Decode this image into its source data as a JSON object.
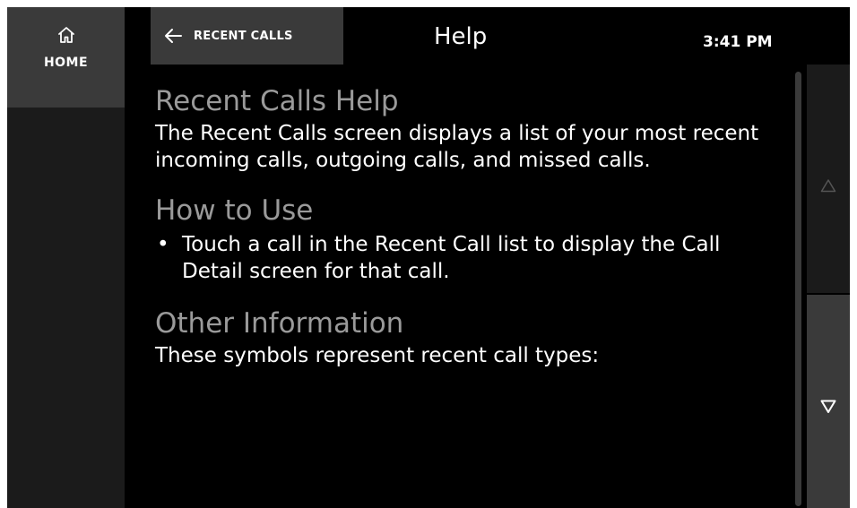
{
  "nav": {
    "home_label": "HOME",
    "home_icon": "home-icon"
  },
  "header": {
    "back_label": "RECENT CALLS",
    "back_icon": "arrow-left-icon",
    "title": "Help",
    "time": "3:41 PM"
  },
  "content": {
    "section1": {
      "heading": "Recent Calls Help",
      "body": "The Recent Calls screen displays a list of your most recent incoming calls, outgoing calls, and missed calls."
    },
    "section2": {
      "heading": "How to Use",
      "bullet_mark": "•",
      "bullet": "Touch a call in the Recent Call list to display the Call Detail screen for that call."
    },
    "section3": {
      "heading": "Other Information",
      "body": "These symbols represent recent call types:"
    }
  },
  "scroll": {
    "up_icon": "triangle-up-icon",
    "down_icon": "triangle-down-icon"
  },
  "colors": {
    "background": "#000000",
    "panel": "#3a3a3a",
    "heading": "#9a9a9a",
    "text": "#ffffff"
  }
}
